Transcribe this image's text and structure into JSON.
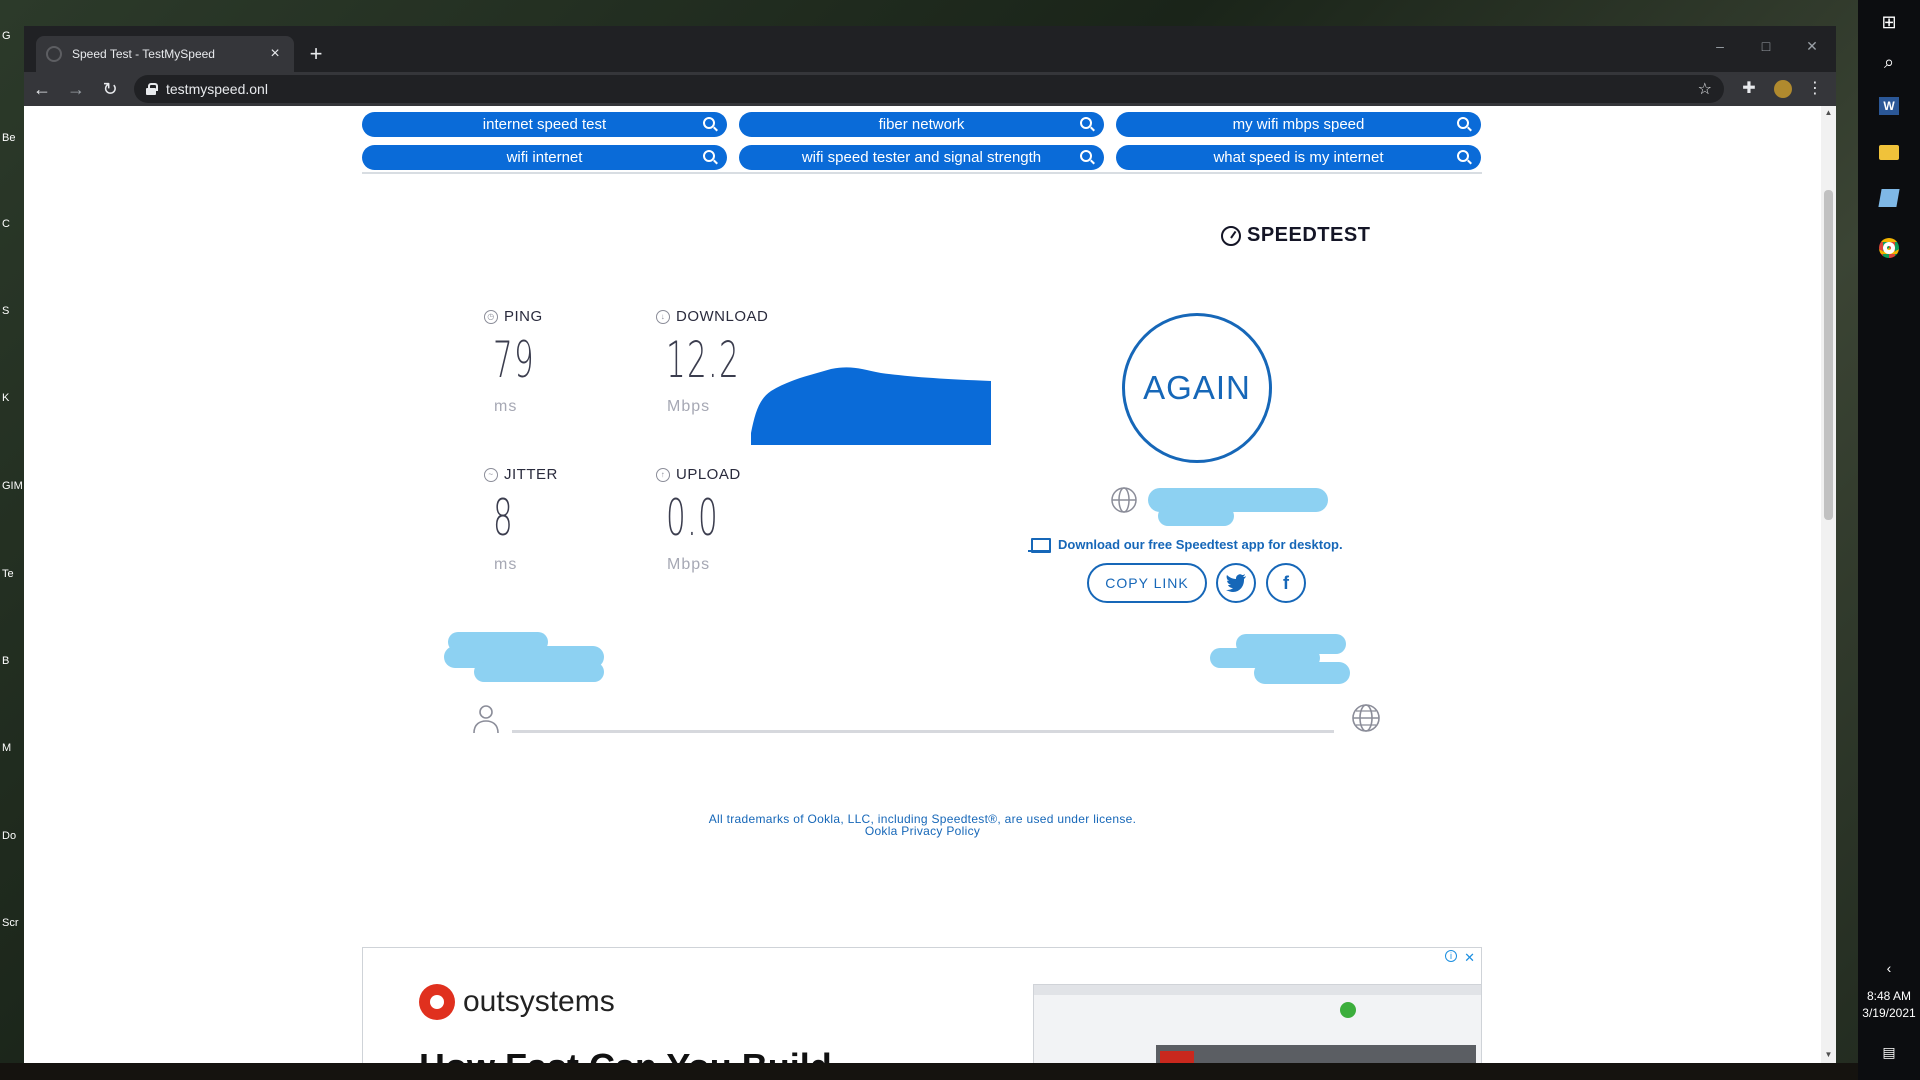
{
  "desktop": {
    "icons": [
      "G",
      "Be",
      "C",
      "S",
      "K",
      "GIM",
      "Te",
      "B",
      "M",
      "Do",
      "Scr"
    ]
  },
  "taskbar": {
    "time": "8:48 AM",
    "date": "3/19/2021"
  },
  "browser": {
    "tab_title": "Speed Test - TestMySpeed",
    "url": "testmyspeed.onl"
  },
  "search_pills": [
    {
      "label": "internet speed test"
    },
    {
      "label": "fiber network"
    },
    {
      "label": "my wifi mbps speed"
    },
    {
      "label": "wifi internet"
    },
    {
      "label": "wifi speed tester and signal strength"
    },
    {
      "label": "what speed is my internet"
    }
  ],
  "speedtest": {
    "brand": "SPEEDTEST",
    "ping": {
      "label": "PING",
      "value": "79",
      "unit": "ms"
    },
    "download": {
      "label": "DOWNLOAD",
      "value": "12.2",
      "unit": "Mbps"
    },
    "jitter": {
      "label": "JITTER",
      "value": "8",
      "unit": "ms"
    },
    "upload": {
      "label": "UPLOAD",
      "value": "0.0",
      "unit": "Mbps"
    },
    "again_label": "AGAIN",
    "download_app": "Download our free Speedtest app for desktop.",
    "copy_link": "COPY LINK",
    "accent_color": "#1667b8"
  },
  "footer": {
    "trademark": "All trademarks of Ookla, LLC, including Speedtest®, are used under license.",
    "privacy": "Ookla Privacy Policy"
  },
  "ad": {
    "brand": "outsystems",
    "headline": "How Fast Can You Build"
  }
}
